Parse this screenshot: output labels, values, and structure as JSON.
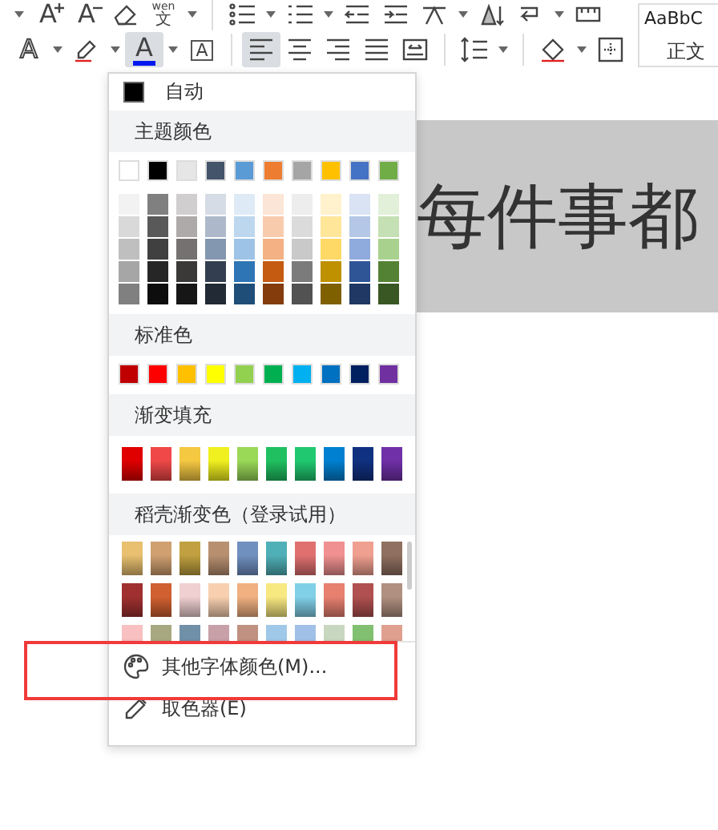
{
  "toolbar": {
    "row1": [
      {
        "kind": "caret"
      },
      {
        "kind": "grow-font",
        "glyph": "A"
      },
      {
        "kind": "shrink-font",
        "glyph": "A"
      },
      {
        "kind": "eraser"
      },
      {
        "kind": "phonetic",
        "glyph": "文",
        "ruby": "wen"
      },
      {
        "kind": "caret"
      },
      {
        "kind": "divider"
      },
      {
        "kind": "bullets"
      },
      {
        "kind": "caret"
      },
      {
        "kind": "numbering"
      },
      {
        "kind": "caret"
      },
      {
        "kind": "outdent"
      },
      {
        "kind": "indent"
      },
      {
        "kind": "direction"
      },
      {
        "kind": "caret"
      },
      {
        "kind": "sort"
      },
      {
        "kind": "para"
      },
      {
        "kind": "caret"
      },
      {
        "kind": "table"
      }
    ],
    "row2": [
      {
        "kind": "outline-font",
        "glyph": "A",
        "selected": false
      },
      {
        "kind": "caret",
        "selected": false
      },
      {
        "kind": "highlighter",
        "selected": false
      },
      {
        "kind": "caret",
        "selected": false
      },
      {
        "kind": "font-color",
        "glyph": "A",
        "selected": true
      },
      {
        "kind": "caret",
        "selected": false
      },
      {
        "kind": "boxed-font",
        "glyph": "A",
        "selected": false
      },
      {
        "kind": "divider"
      },
      {
        "kind": "align-left",
        "selected": true
      },
      {
        "kind": "align-center",
        "selected": false
      },
      {
        "kind": "align-right",
        "selected": false
      },
      {
        "kind": "justify",
        "selected": false
      },
      {
        "kind": "distribute",
        "selected": false
      },
      {
        "kind": "divider"
      },
      {
        "kind": "line-spacing",
        "selected": false
      },
      {
        "kind": "caret",
        "selected": false
      },
      {
        "kind": "divider"
      },
      {
        "kind": "shading",
        "selected": false
      },
      {
        "kind": "caret",
        "selected": false
      },
      {
        "kind": "borders",
        "selected": false
      }
    ],
    "styles": {
      "preview": "AaBbC",
      "name": "正文"
    }
  },
  "document": {
    "text": "每件事都"
  },
  "menu": {
    "auto": {
      "label": "自动",
      "color": "#000000"
    },
    "theme_title": "主题颜色",
    "theme": [
      {
        "color": "#ffffff"
      },
      {
        "color": "#000000"
      },
      {
        "color": "#e7e6e6"
      },
      {
        "color": "#44546a"
      },
      {
        "color": "#5b9bd5"
      },
      {
        "color": "#ed7d31"
      },
      {
        "color": "#a5a5a5"
      },
      {
        "color": "#ffc000"
      },
      {
        "color": "#4472c4"
      },
      {
        "color": "#70ad47"
      }
    ],
    "shades": [
      [
        {
          "color": "#f2f2f2"
        },
        {
          "color": "#808080"
        },
        {
          "color": "#d0cece"
        },
        {
          "color": "#d6dce5"
        },
        {
          "color": "#deebf7"
        },
        {
          "color": "#fbe5d6"
        },
        {
          "color": "#ededed"
        },
        {
          "color": "#fff2cc"
        },
        {
          "color": "#dae3f3"
        },
        {
          "color": "#e2f0d9"
        }
      ],
      [
        {
          "color": "#d9d9d9"
        },
        {
          "color": "#595959"
        },
        {
          "color": "#aeaaaa"
        },
        {
          "color": "#adb9ca"
        },
        {
          "color": "#bdd7ee"
        },
        {
          "color": "#f8cbad"
        },
        {
          "color": "#dbdbdb"
        },
        {
          "color": "#ffe699"
        },
        {
          "color": "#b4c7e7"
        },
        {
          "color": "#c5e0b4"
        }
      ],
      [
        {
          "color": "#bfbfbf"
        },
        {
          "color": "#404040"
        },
        {
          "color": "#767171"
        },
        {
          "color": "#8497b0"
        },
        {
          "color": "#9dc3e6"
        },
        {
          "color": "#f4b183"
        },
        {
          "color": "#c9c9c9"
        },
        {
          "color": "#ffd966"
        },
        {
          "color": "#8faadc"
        },
        {
          "color": "#a9d18e"
        }
      ],
      [
        {
          "color": "#a6a6a6"
        },
        {
          "color": "#262626"
        },
        {
          "color": "#3b3838"
        },
        {
          "color": "#333f50"
        },
        {
          "color": "#2e75b6"
        },
        {
          "color": "#c55a11"
        },
        {
          "color": "#7b7b7b"
        },
        {
          "color": "#bf9000"
        },
        {
          "color": "#2f5597"
        },
        {
          "color": "#548235"
        }
      ],
      [
        {
          "color": "#808080"
        },
        {
          "color": "#0d0d0d"
        },
        {
          "color": "#171616"
        },
        {
          "color": "#222a35"
        },
        {
          "color": "#1f4e79"
        },
        {
          "color": "#843c0c"
        },
        {
          "color": "#525252"
        },
        {
          "color": "#7f6000"
        },
        {
          "color": "#203864"
        },
        {
          "color": "#385723"
        }
      ]
    ],
    "standard_title": "标准色",
    "standard": [
      {
        "color": "#c00000"
      },
      {
        "color": "#ff0000"
      },
      {
        "color": "#ffc000"
      },
      {
        "color": "#ffff00"
      },
      {
        "color": "#92d050"
      },
      {
        "color": "#00b050"
      },
      {
        "color": "#00b0f0"
      },
      {
        "color": "#0070c0"
      },
      {
        "color": "#002060"
      },
      {
        "color": "#7030a0"
      }
    ],
    "gradient_title": "渐变填充",
    "gradients": [
      {
        "color": "#e00000"
      },
      {
        "color": "#f04848"
      },
      {
        "color": "#f5c842"
      },
      {
        "color": "#f0f020"
      },
      {
        "color": "#9ad858"
      },
      {
        "color": "#20c060"
      },
      {
        "color": "#20c870"
      },
      {
        "color": "#0080d0"
      },
      {
        "color": "#103080"
      },
      {
        "color": "#7030a8"
      }
    ],
    "shell_title": "稻壳渐变色（登录试用）",
    "shell": [
      [
        {
          "color": "#e8c070"
        },
        {
          "color": "#d0a070"
        },
        {
          "color": "#c0a040"
        },
        {
          "color": "#b89070"
        },
        {
          "color": "#7090c0"
        },
        {
          "color": "#50b0b8"
        },
        {
          "color": "#e07070"
        },
        {
          "color": "#f09090"
        },
        {
          "color": "#f0a090"
        },
        {
          "color": "#907060"
        }
      ],
      [
        {
          "color": "#a03030"
        },
        {
          "color": "#d06030"
        },
        {
          "color": "#f0d0d0"
        },
        {
          "color": "#f8d0b0"
        },
        {
          "color": "#f0b080"
        },
        {
          "color": "#f8e880"
        },
        {
          "color": "#80d0e8"
        },
        {
          "color": "#e88070"
        },
        {
          "color": "#b05050"
        },
        {
          "color": "#b09080"
        }
      ],
      [
        {
          "color": "#f8c0c0"
        },
        {
          "color": "#a8a880"
        },
        {
          "color": "#7090a8"
        },
        {
          "color": "#c8a0a8"
        },
        {
          "color": "#c09080"
        },
        {
          "color": "#a0c8e8"
        },
        {
          "color": "#a0c0e8"
        },
        {
          "color": "#c8d8c0"
        },
        {
          "color": "#80c070"
        },
        {
          "color": "#e0a090"
        }
      ]
    ],
    "actions": [
      {
        "kind": "palette",
        "label": "其他字体颜色(M)..."
      },
      {
        "kind": "eyedropper",
        "label": "取色器(E)"
      }
    ]
  }
}
